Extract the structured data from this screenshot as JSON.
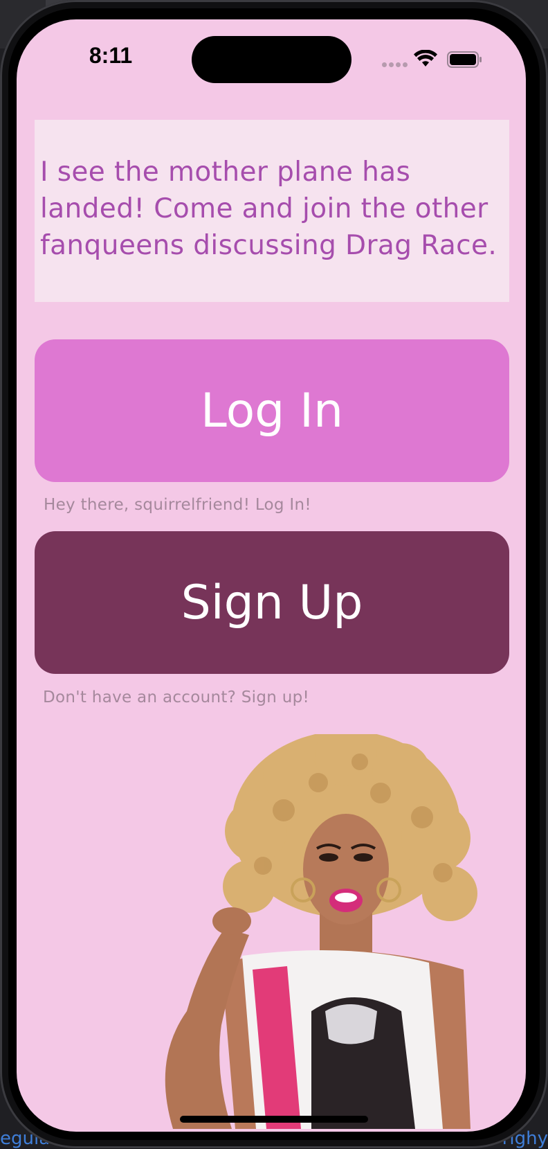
{
  "status_bar": {
    "time": "8:11"
  },
  "welcome": {
    "message": "I see the mother plane has landed! Come and join the other fanqueens discussing Drag Race."
  },
  "login": {
    "button_label": "Log In",
    "hint": "Hey there, squirrelfriend! Log In!"
  },
  "signup": {
    "button_label": "Sign Up",
    "hint": "Don't have an account? Sign up!"
  },
  "canvas": {
    "bottom_left_text": "egulars",
    "bottom_right_text": "#righy"
  },
  "colors": {
    "screen_background": "#f4c8e6",
    "message_box": "#f6e3ef",
    "message_text": "#a64dad",
    "login_button": "#de78d2",
    "signup_button": "#773459",
    "hint_text": "#a5889c"
  },
  "icons": {
    "wifi": "wifi-icon",
    "battery": "battery-icon",
    "cellular": "cellular-signal-icon"
  }
}
